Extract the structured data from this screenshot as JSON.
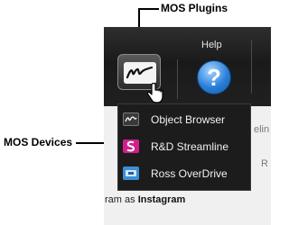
{
  "callouts": {
    "top": "MOS Plugins",
    "left": "MOS Devices"
  },
  "toolbar": {
    "plugin_icon": "mos-signature-icon",
    "help_label": "Help",
    "help_glyph": "?",
    "cut_label_left": "",
    "cut_label_right": ""
  },
  "dropdown": {
    "items": [
      {
        "label": "Object Browser",
        "icon": "object-browser-icon",
        "color": "#3a3a3a"
      },
      {
        "label": "R&D Streamline",
        "icon": "streamline-icon",
        "color": "#d11f8c"
      },
      {
        "label": "Ross OverDrive",
        "icon": "overdrive-icon",
        "color": "#3b8fd6"
      }
    ]
  },
  "background": {
    "ghost_right_top": "elin",
    "ghost_right_mid": "R",
    "bottom_prefix": "ram as ",
    "bottom_bold": "Instagram"
  }
}
